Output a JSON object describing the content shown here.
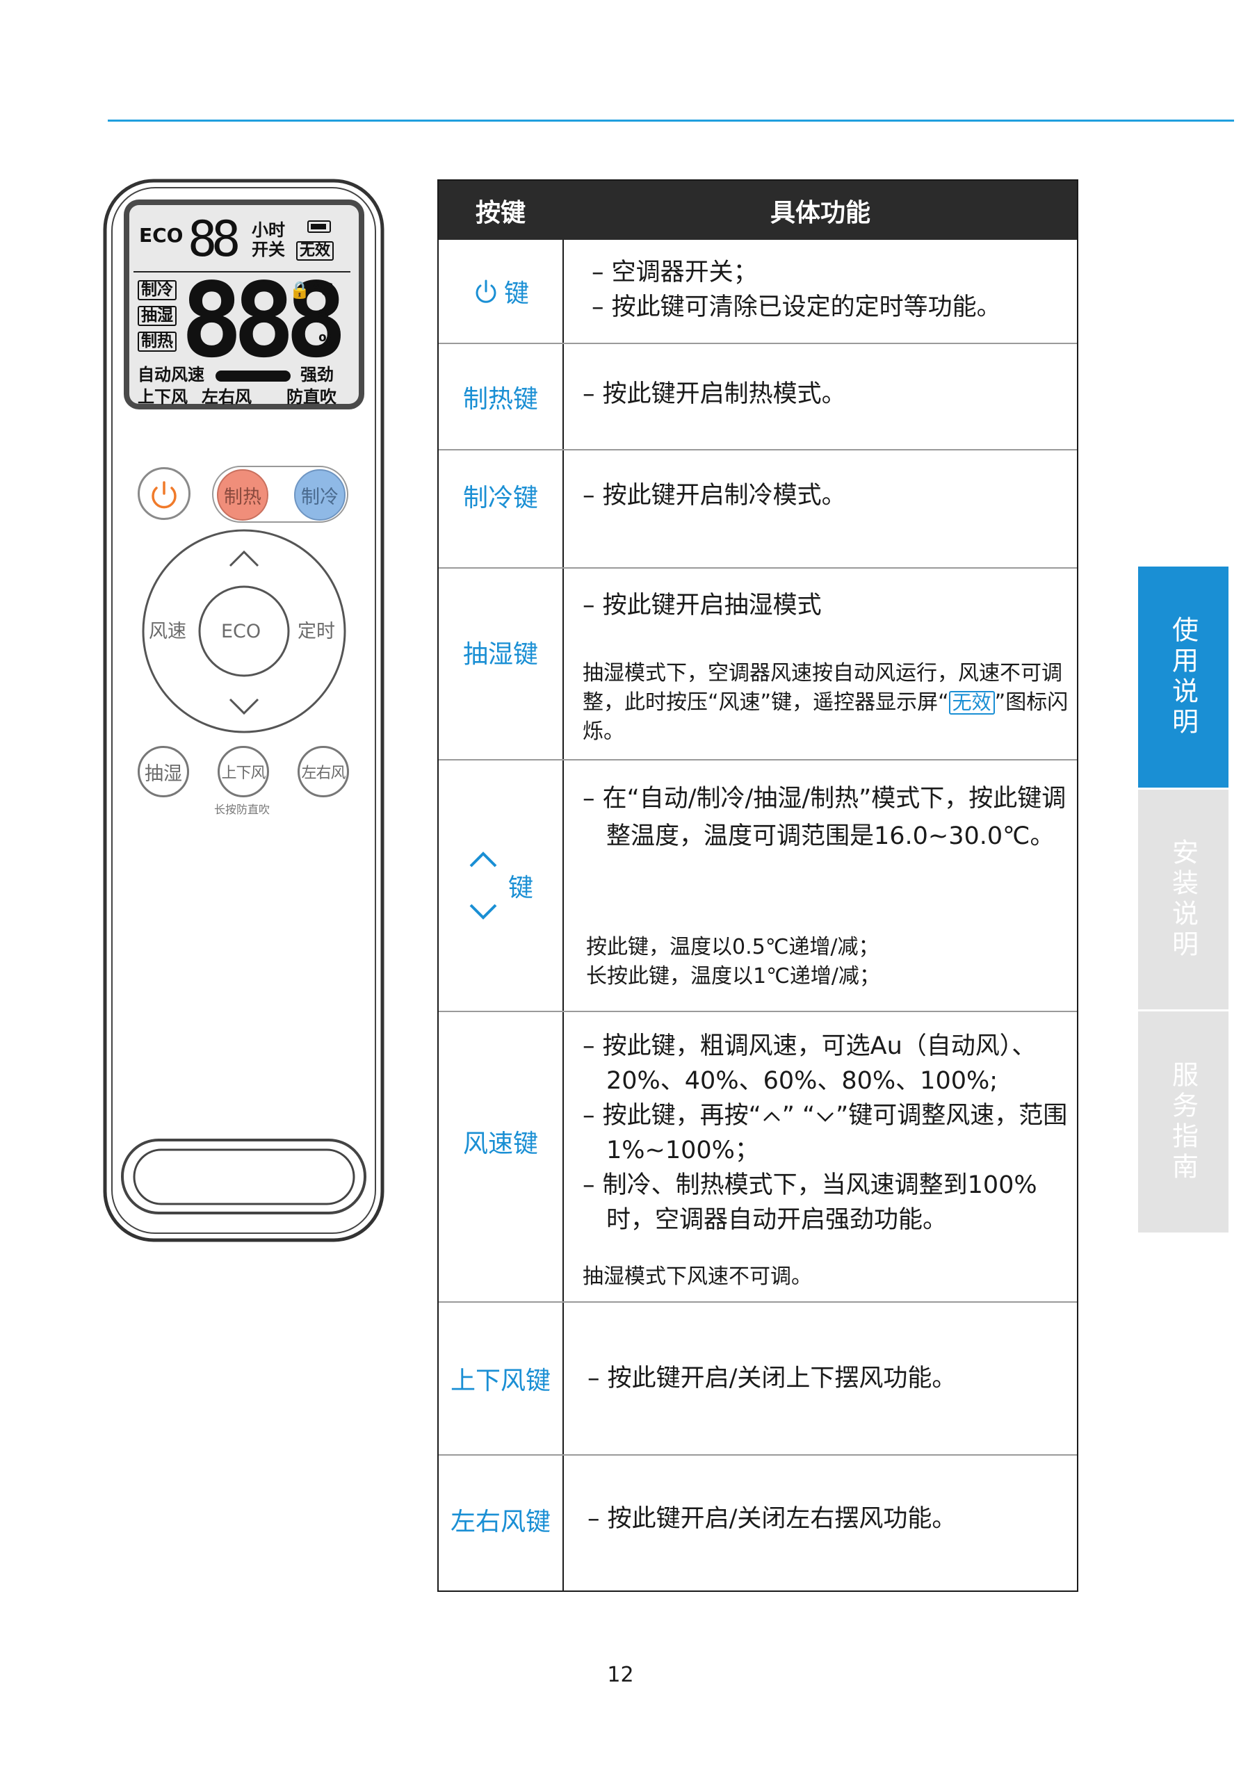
{
  "remote": {
    "lcd": {
      "eco": "ECO",
      "timer_digits": "88",
      "hours": "小时",
      "on_off": "开关",
      "invalid": "无效",
      "mode_cool": "制冷",
      "mode_dry": "抽湿",
      "mode_heat": "制热",
      "big_digits": "888",
      "celsius": "℃",
      "percent": "%",
      "auto_fan": "自动风速",
      "strong": "强劲",
      "vertical_swing": "上下风",
      "horizontal_swing": "左右风",
      "anti_direct": "防直吹"
    },
    "buttons": {
      "heat": "制热",
      "cool": "制冷",
      "fan_speed": "风速",
      "eco": "ECO",
      "timer": "定时",
      "dry": "抽湿",
      "vertical": "上下风",
      "horizontal": "左右风",
      "long_press_hint": "长按防直吹"
    }
  },
  "table": {
    "header": {
      "key": "按键",
      "function": "具体功能"
    },
    "rows": [
      {
        "key": "键",
        "items": [
          "– 空调器开关；",
          "– 按此键可清除已设定的定时等功能。"
        ]
      },
      {
        "key": "制热键",
        "items": [
          "– 按此键开启制热模式。"
        ]
      },
      {
        "key": "制冷键",
        "items": [
          "– 按此键开启制冷模式。"
        ]
      },
      {
        "key": "抽湿键",
        "items": [
          "– 按此键开启抽湿模式"
        ],
        "note_a": "抽湿模式下，空调器风速按自动风运行，风速不可调整，此时按压“风速”键，遥控器显示屏",
        "note_quote_open": "“",
        "note_box": "无效",
        "note_b": "”图标闪烁。"
      },
      {
        "key": "键",
        "items": [
          "– 在“自动/制冷/抽湿/制热”模式下，按此键调整温度，温度可调范围是16.0~30.0℃。"
        ],
        "notes": [
          "按此键，温度以0.5℃递增/减；",
          "长按此键，温度以1℃递增/减；"
        ]
      },
      {
        "key": "风速键",
        "items": [
          "– 按此键，粗调风速，可选Au（自动风）、20%、40%、60%、80%、100%;"
        ],
        "item2_a": "– 按此键，再按“",
        "item2_b": "”  “",
        "item2_c": "”键可调整风速，范围1%~100%；",
        "item3": "– 制冷、制热模式下，当风速调整到100%时，空调器自动开启强劲功能。",
        "note": "抽湿模式下风速不可调。"
      },
      {
        "key": "上下风键",
        "items": [
          "– 按此键开启/关闭上下摆风功能。"
        ]
      },
      {
        "key": "左右风键",
        "items": [
          "– 按此键开启/关闭左右摆风功能。"
        ]
      }
    ]
  },
  "side_tabs": [
    {
      "label": "使用说明",
      "active": true
    },
    {
      "label": "安装说明",
      "active": false
    },
    {
      "label": "服务指南",
      "active": false
    }
  ],
  "page_number": "12",
  "colors": {
    "accent_blue": "#1a8fd4",
    "rule_blue": "#1f9fde",
    "heat_button": "#f08e7a",
    "cool_button": "#8fb9e6",
    "power_orange": "#f07a2a",
    "header_dark": "#2b2b2b"
  }
}
